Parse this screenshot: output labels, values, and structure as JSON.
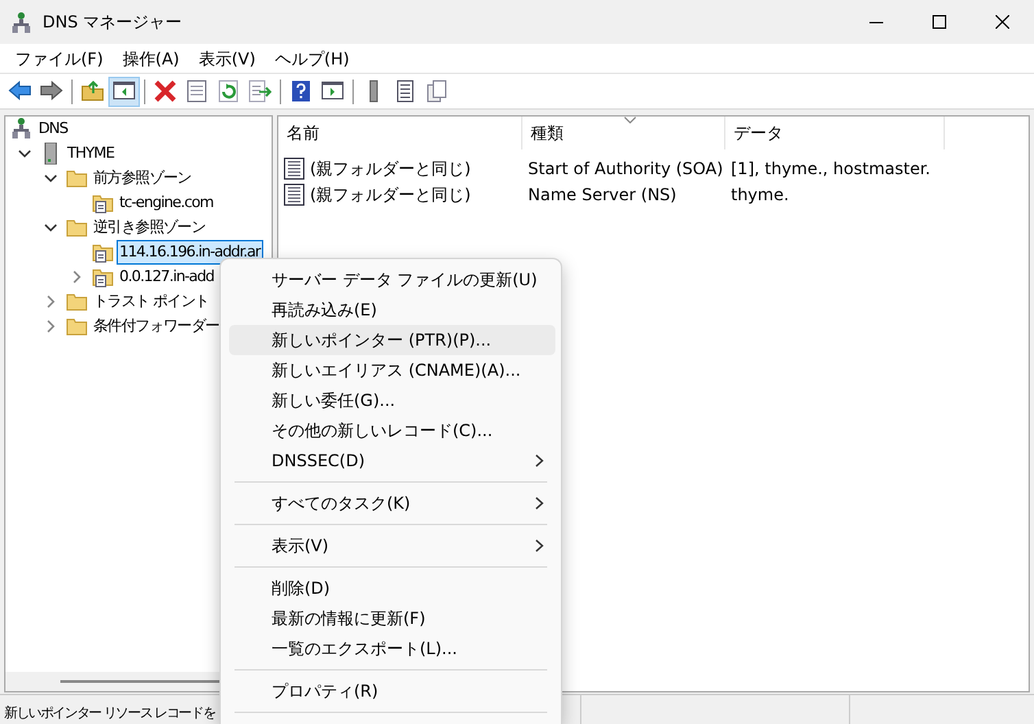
{
  "window": {
    "title": "DNS マネージャー"
  },
  "menu_bar": [
    "ファイル(F)",
    "操作(A)",
    "表示(V)",
    "ヘルプ(H)"
  ],
  "toolbar": {
    "buttons": [
      {
        "pressed": false
      },
      {
        "pressed": false
      },
      {
        "pressed": false
      },
      {
        "pressed": true
      },
      {
        "pressed": false
      },
      {
        "pressed": false
      },
      {
        "pressed": false
      },
      {
        "pressed": false
      },
      {
        "pressed": false
      },
      {
        "pressed": false
      },
      {
        "pressed": false
      },
      {
        "pressed": false
      },
      {
        "pressed": false
      }
    ]
  },
  "tree": [
    {
      "label": "DNS",
      "kind": "root",
      "selected": false,
      "children": [
        {
          "label": "THYME",
          "kind": "server",
          "selected": false,
          "expanded": true,
          "children": [
            {
              "label": "前方参照ゾーン",
              "kind": "folder",
              "selected": false,
              "expanded": true,
              "children": [
                {
                  "label": "tc-engine.com",
                  "kind": "zone",
                  "selected": false
                }
              ]
            },
            {
              "label": "逆引き参照ゾーン",
              "kind": "folder",
              "selected": false,
              "expanded": true,
              "children": [
                {
                  "label": "114.16.196.in-addr.ar",
                  "kind": "zone",
                  "selected": true
                },
                {
                  "label": "0.0.127.in-add",
                  "kind": "zone",
                  "selected": false,
                  "expanded": false
                }
              ]
            },
            {
              "label": "トラスト ポイント",
              "kind": "folder",
              "selected": false,
              "expanded": false
            },
            {
              "label": "条件付フォワーダー",
              "kind": "folder",
              "selected": false,
              "expanded": false
            }
          ]
        }
      ]
    }
  ],
  "table": {
    "columns": [
      {
        "label": "名前",
        "sorted": false
      },
      {
        "label": "種類",
        "sorted": true
      },
      {
        "label": "データ",
        "sorted": false
      }
    ],
    "rows": [
      {
        "name": "(親フォルダーと同じ)",
        "type": "Start of Authority (SOA)",
        "data": "[1], thyme., hostmaster."
      },
      {
        "name": "(親フォルダーと同じ)",
        "type": "Name Server (NS)",
        "data": "thyme."
      }
    ]
  },
  "context_menu": [
    {
      "kind": "item",
      "label": "サーバー データ ファイルの更新(U)",
      "selected": false,
      "submenu": false
    },
    {
      "kind": "item",
      "label": "再読み込み(E)",
      "selected": false,
      "submenu": false
    },
    {
      "kind": "item",
      "label": "新しいポインター (PTR)(P)...",
      "selected": true,
      "submenu": false
    },
    {
      "kind": "item",
      "label": "新しいエイリアス (CNAME)(A)...",
      "selected": false,
      "submenu": false
    },
    {
      "kind": "item",
      "label": "新しい委任(G)...",
      "selected": false,
      "submenu": false
    },
    {
      "kind": "item",
      "label": "その他の新しいレコード(C)...",
      "selected": false,
      "submenu": false
    },
    {
      "kind": "item",
      "label": "DNSSEC(D)",
      "selected": false,
      "submenu": true
    },
    {
      "kind": "separator"
    },
    {
      "kind": "item",
      "label": "すべてのタスク(K)",
      "selected": false,
      "submenu": true
    },
    {
      "kind": "separator"
    },
    {
      "kind": "item",
      "label": "表示(V)",
      "selected": false,
      "submenu": true
    },
    {
      "kind": "separator"
    },
    {
      "kind": "item",
      "label": "削除(D)",
      "selected": false,
      "submenu": false
    },
    {
      "kind": "item",
      "label": "最新の情報に更新(F)",
      "selected": false,
      "submenu": false
    },
    {
      "kind": "item",
      "label": "一覧のエクスポート(L)...",
      "selected": false,
      "submenu": false
    },
    {
      "kind": "separator"
    },
    {
      "kind": "item",
      "label": "プロパティ(R)",
      "selected": false,
      "submenu": false
    },
    {
      "kind": "separator"
    }
  ],
  "status_bar": [
    "新しいポインター リソース レコードを"
  ]
}
